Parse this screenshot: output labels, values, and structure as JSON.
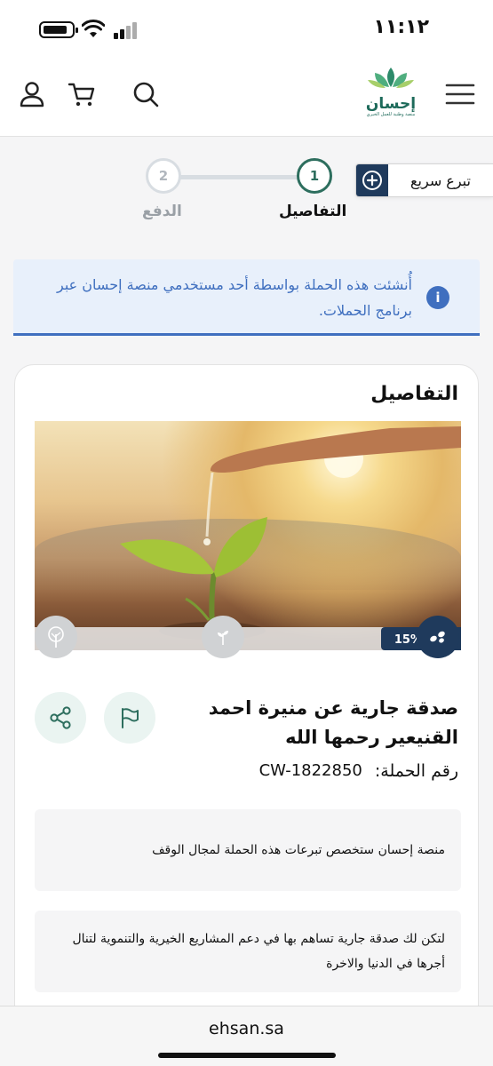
{
  "status_bar": {
    "time": "١١:١٢"
  },
  "header": {
    "logo": {
      "name": "إحسان",
      "subtitle": "منصة وطنية للعمل الخيري"
    },
    "icons": [
      "menu-icon",
      "search-icon",
      "cart-icon",
      "user-icon"
    ]
  },
  "steps": {
    "items": [
      {
        "number": "1",
        "label": "التفاصيل",
        "active": true
      },
      {
        "number": "2",
        "label": "الدفع",
        "active": false
      }
    ]
  },
  "quick_donate": {
    "label": "تبرع سريع"
  },
  "info_banner": {
    "text": "أُنشئت هذه الحملة بواسطة أحد مستخدمي منصة إحسان عبر برنامج الحملات."
  },
  "details": {
    "section_title": "التفاصيل",
    "progress": {
      "percent_label": "15%",
      "value": 0.15
    },
    "campaign_title": "صدقة جارية عن منيرة احمد القنيعير رحمها الله",
    "campaign_number_label": "رقم الحملة:",
    "campaign_number": "CW-1822850",
    "notes": [
      "منصة إحسان ستخصص تبرعات هذه الحملة لمجال الوقف",
      "لتكن لك صدقة جارية تساهم بها في دعم المشاريع الخيرية والتنموية لتنال أجرها في الدنيا والاخرة"
    ]
  },
  "browser": {
    "url": "ehsan.sa"
  },
  "colors": {
    "brand_green": "#2d6e5e",
    "navy": "#1f3a5c",
    "info_blue": "#3f6fbf"
  }
}
